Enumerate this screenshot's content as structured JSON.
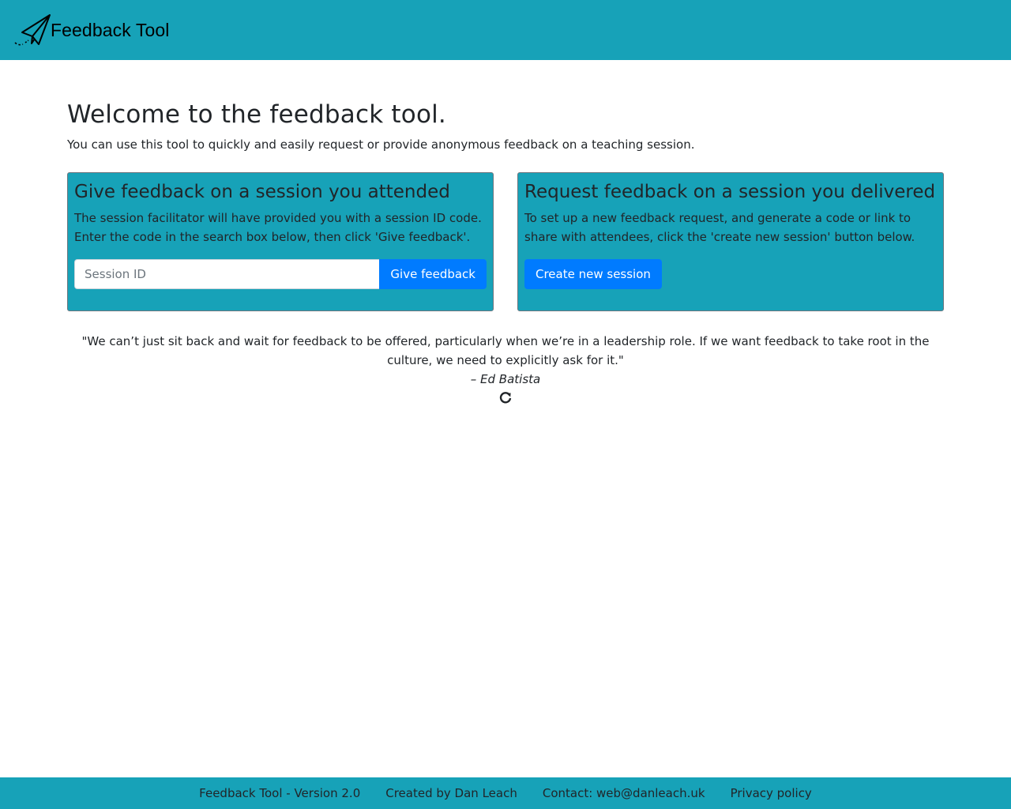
{
  "header": {
    "brand": "Feedback Tool",
    "logo_icon": "paper-plane-icon"
  },
  "main": {
    "title": "Welcome to the feedback tool.",
    "lead": "You can use this tool to quickly and easily request or provide anonymous feedback on a teaching session."
  },
  "give_card": {
    "title": "Give feedback on a session you attended",
    "text": "The session facilitator will have provided you with a session ID code. Enter the code in the search box below, then click 'Give feedback'.",
    "input_placeholder": "Session ID",
    "input_value": "",
    "button_label": "Give feedback"
  },
  "request_card": {
    "title": "Request feedback on a session you delivered",
    "text": "To set up a new feedback request, and generate a code or link to share with attendees, click the 'create new session' button below.",
    "button_label": "Create new session"
  },
  "quote": {
    "text": "\"We can’t just sit back and wait for feedback to be offered, particularly when we’re in a leadership role. If we want feedback to take root in the culture, we need to explicitly ask for it.\"",
    "author": "– Ed Batista",
    "refresh_icon": "refresh-icon"
  },
  "footer": {
    "version": "Feedback Tool - Version 2.0",
    "created_by": "Created by Dan Leach",
    "contact": "Contact: web@danleach.uk",
    "privacy": "Privacy policy"
  },
  "colors": {
    "accent": "#17a2b8",
    "primary": "#007bff",
    "text": "#212529"
  }
}
